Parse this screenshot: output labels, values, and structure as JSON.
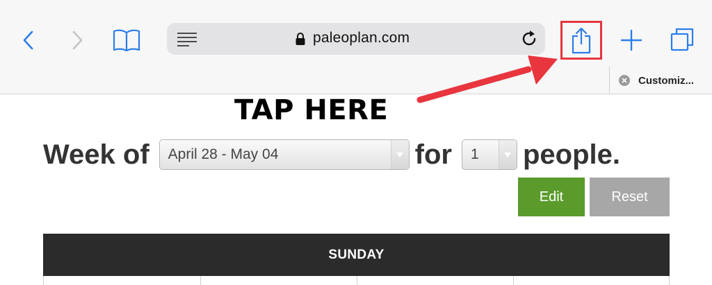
{
  "browser": {
    "url": "paleoplan.com",
    "tab_label": "Customiz...",
    "icons": {
      "back": "chevron-left-icon",
      "forward": "chevron-right-icon",
      "bookmarks": "book-icon",
      "reader": "reader-view-icon",
      "lock": "lock-icon",
      "reload": "reload-icon",
      "share": "share-icon",
      "new_tab": "plus-icon",
      "tabs": "tabs-icon",
      "close_tab": "close-icon"
    }
  },
  "annotation": {
    "text": "TAP HERE",
    "color": "#e8353e"
  },
  "planner": {
    "week_prefix": "Week of",
    "week_value": "April 28 - May 04",
    "for_text": "for",
    "people_value": "1",
    "people_suffix": "people.",
    "edit_label": "Edit",
    "reset_label": "Reset",
    "day_header": "SUNDAY"
  },
  "colors": {
    "accent": "#2b7de9",
    "edit_green": "#5a9b2c",
    "reset_gray": "#a7a7a7",
    "header_dark": "#2b2b2b"
  }
}
